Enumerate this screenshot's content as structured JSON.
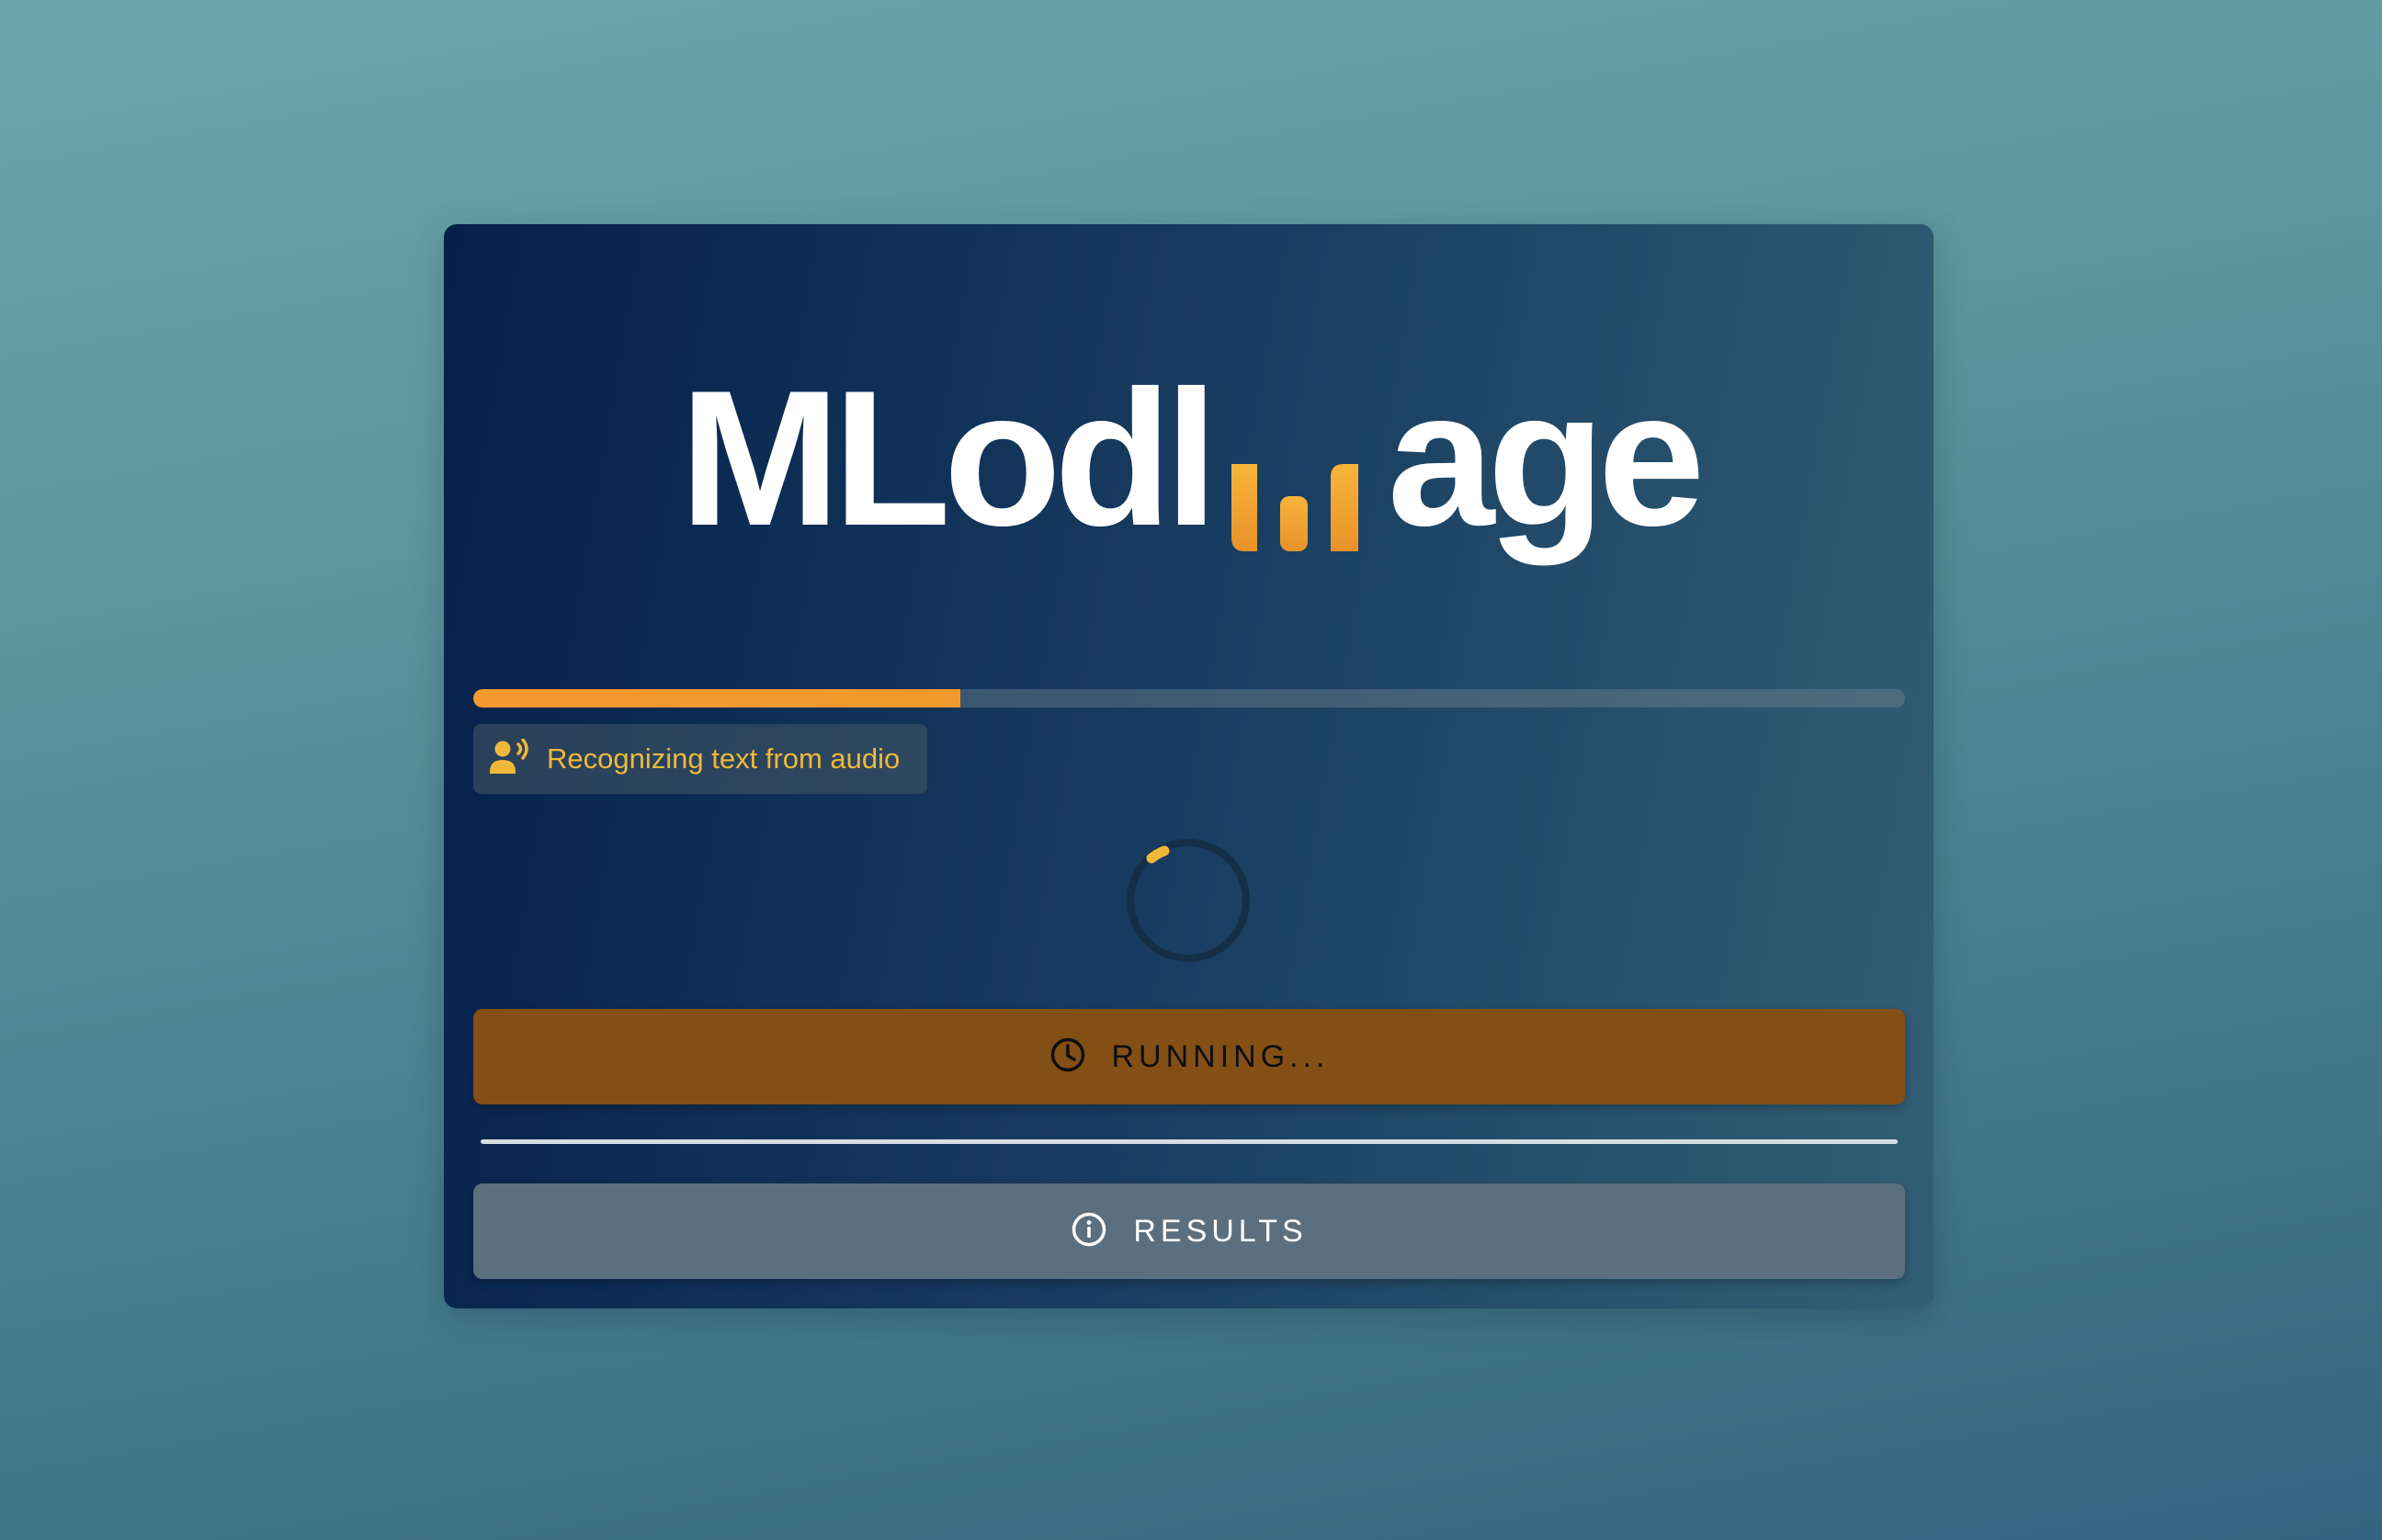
{
  "logo": {
    "text_left": "MLodl",
    "text_right": "age",
    "accent_color": "#f3a32f",
    "icon": "waveform-bars-icon"
  },
  "progress": {
    "value_percent": 34,
    "fill_color": "#f3982f"
  },
  "status": {
    "icon": "voice-recognition-icon",
    "text": "Recognizing text from audio",
    "text_color": "#f0b83a"
  },
  "spinner": {
    "icon": "loading-spinner-icon",
    "color": "#f0b83a"
  },
  "buttons": {
    "running": {
      "icon": "clock-icon",
      "label": "RUNNING...",
      "background": "#834f14"
    },
    "results": {
      "icon": "info-icon",
      "label": "RESULTS",
      "background": "#5b6f7e"
    }
  }
}
